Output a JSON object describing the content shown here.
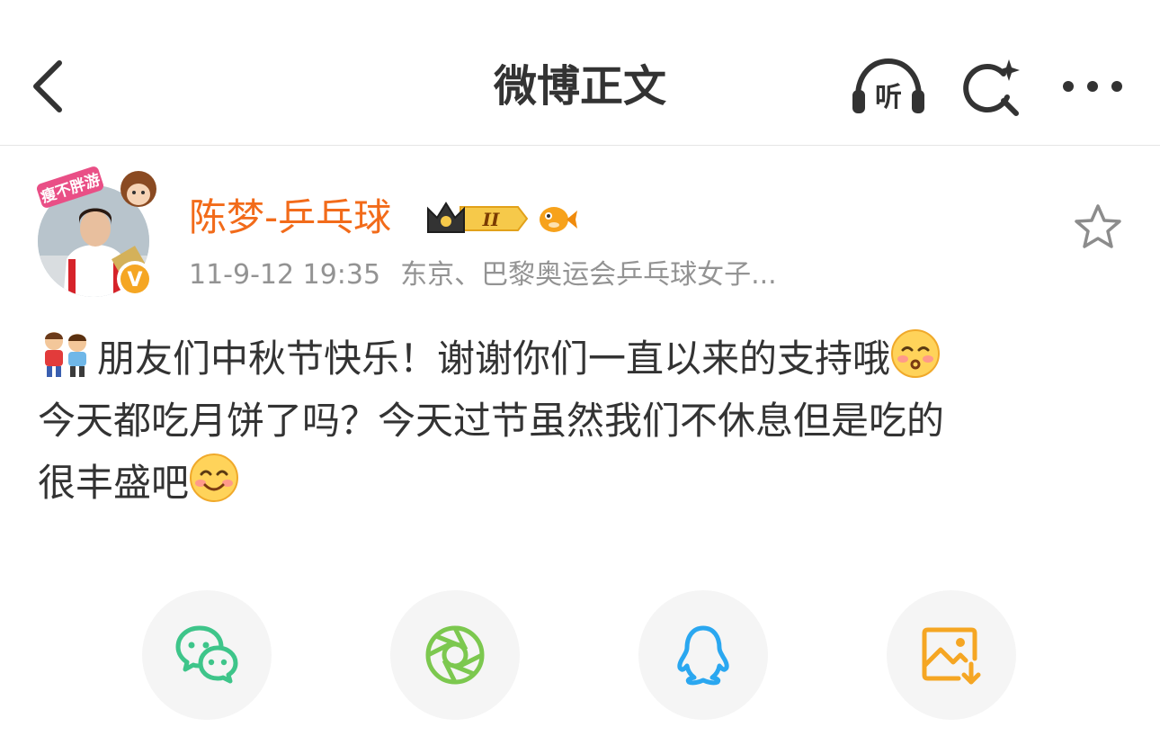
{
  "nav": {
    "title": "微博正文",
    "listen_label": "听",
    "icons": [
      "chevron-left-icon",
      "headphones-icon",
      "search-sparkle-icon",
      "more-dots-icon"
    ]
  },
  "post": {
    "author": "陈梦-乒乓球",
    "level_badge": "II",
    "time": "11-9-12 19:35",
    "source": "东京、巴黎奥运会乒乓球女子...",
    "lines": [
      "朋友们中秋节快乐！谢谢你们一直以来的支持哦",
      "今天都吃月饼了吗？今天过节虽然我们不休息但是吃的",
      "很丰盛吧"
    ],
    "avatar_sticker_text": "瘦不胖游",
    "verified_mark": "V"
  },
  "share": {
    "items": [
      "wechat-icon",
      "moments-icon",
      "qq-icon",
      "save-image-icon"
    ]
  },
  "colors": {
    "author": "#f26b1a",
    "title": "#333333",
    "meta": "#939393",
    "wechat": "#3ec58a",
    "moments": "#7cc84f",
    "qq": "#2aa7f0",
    "save": "#f5a623"
  }
}
